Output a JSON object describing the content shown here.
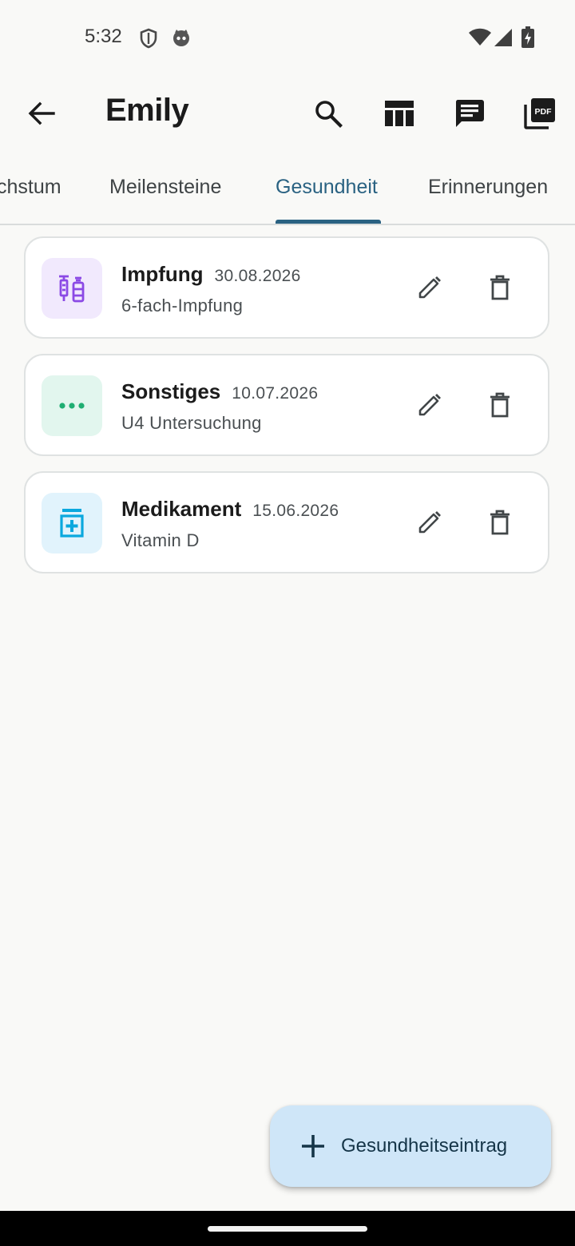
{
  "status_bar": {
    "time": "5:32",
    "left_icons": [
      "shield-icon",
      "cat-face-icon"
    ],
    "right_icons": [
      "wifi-icon",
      "signal-icon",
      "battery-charging-icon"
    ]
  },
  "app_bar": {
    "title": "Emily",
    "actions": [
      "search-icon",
      "table-view-icon",
      "chat-icon",
      "pdf-export-icon"
    ]
  },
  "tabs": {
    "items": [
      {
        "label": "chstum"
      },
      {
        "label": "Meilensteine"
      },
      {
        "label": "Gesundheit"
      },
      {
        "label": "Erinnerungen"
      }
    ],
    "active_index": 2,
    "active_color": "#2a6282"
  },
  "entries": [
    {
      "type": "Impfung",
      "date": "30.08.2026",
      "description": "6-fach-Impfung",
      "icon": "vaccine-icon",
      "icon_bg": "#f1e9fd",
      "icon_color": "#8b49e5"
    },
    {
      "type": "Sonstiges",
      "date": "10.07.2026",
      "description": "U4 Untersuchung",
      "icon": "more-dots-icon",
      "icon_bg": "#e2f6ee",
      "icon_color": "#1fae72"
    },
    {
      "type": "Medikament",
      "date": "15.06.2026",
      "description": "Vitamin D",
      "icon": "medication-icon",
      "icon_bg": "#e1f3fc",
      "icon_color": "#0aa8de"
    }
  ],
  "fab": {
    "label": "Gesundheitseintrag",
    "icon": "plus-icon",
    "background": "#cfe6f8"
  }
}
